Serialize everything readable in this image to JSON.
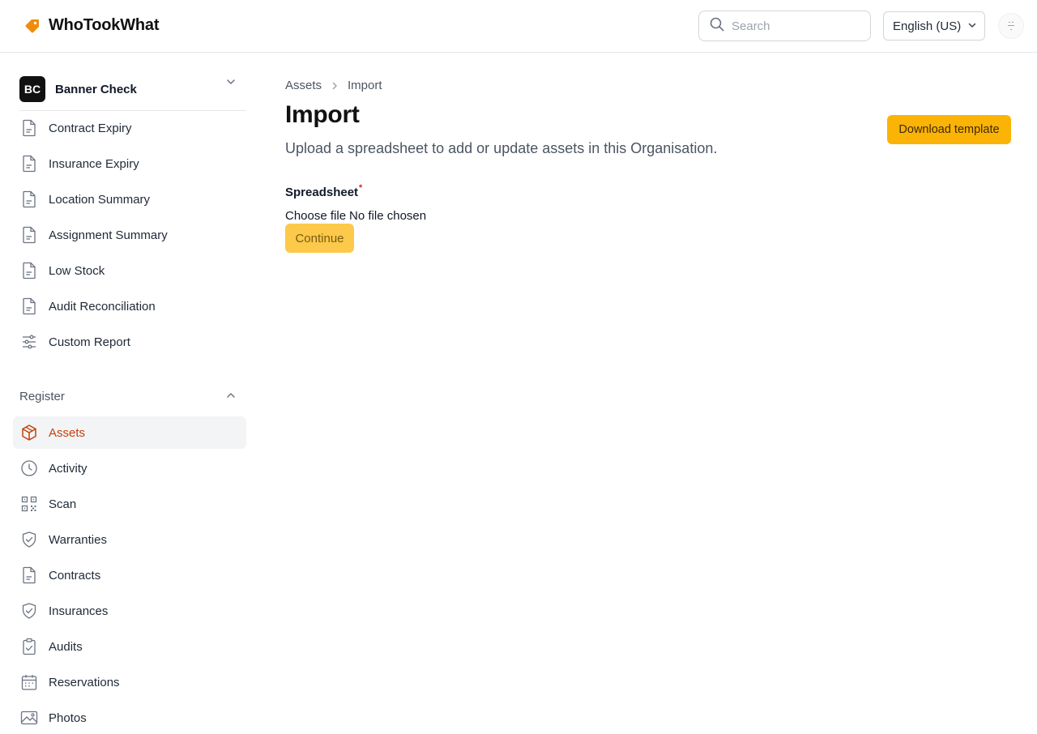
{
  "app": {
    "name": "WhoTookWhat",
    "accent": "#fbb306",
    "active_color": "#c2410c"
  },
  "header": {
    "search_placeholder": "Search",
    "language": "English (US)"
  },
  "sidebar": {
    "org": {
      "initials": "BC",
      "name": "Banner Check"
    },
    "report_items": [
      {
        "label": "Contract Expiry",
        "icon": "document-icon"
      },
      {
        "label": "Insurance Expiry",
        "icon": "document-icon"
      },
      {
        "label": "Location Summary",
        "icon": "document-icon"
      },
      {
        "label": "Assignment Summary",
        "icon": "document-icon"
      },
      {
        "label": "Low Stock",
        "icon": "document-icon"
      },
      {
        "label": "Audit Reconciliation",
        "icon": "document-icon"
      },
      {
        "label": "Custom Report",
        "icon": "sliders-icon"
      }
    ],
    "register_title": "Register",
    "register_items": [
      {
        "label": "Assets",
        "icon": "cube-icon",
        "active": true
      },
      {
        "label": "Activity",
        "icon": "clock-icon"
      },
      {
        "label": "Scan",
        "icon": "qr-code-icon"
      },
      {
        "label": "Warranties",
        "icon": "shield-check-icon"
      },
      {
        "label": "Contracts",
        "icon": "document-icon"
      },
      {
        "label": "Insurances",
        "icon": "shield-check-icon"
      },
      {
        "label": "Audits",
        "icon": "clipboard-check-icon"
      },
      {
        "label": "Reservations",
        "icon": "calendar-icon"
      },
      {
        "label": "Photos",
        "icon": "image-icon"
      }
    ]
  },
  "main": {
    "breadcrumb": [
      "Assets",
      "Import"
    ],
    "title": "Import",
    "description": "Upload a spreadsheet to add or update assets in this Organisation.",
    "download_label": "Download template",
    "field_label": "Spreadsheet",
    "required_mark": "*",
    "file_button": "Choose file",
    "file_status": "No file chosen",
    "continue_label": "Continue"
  }
}
